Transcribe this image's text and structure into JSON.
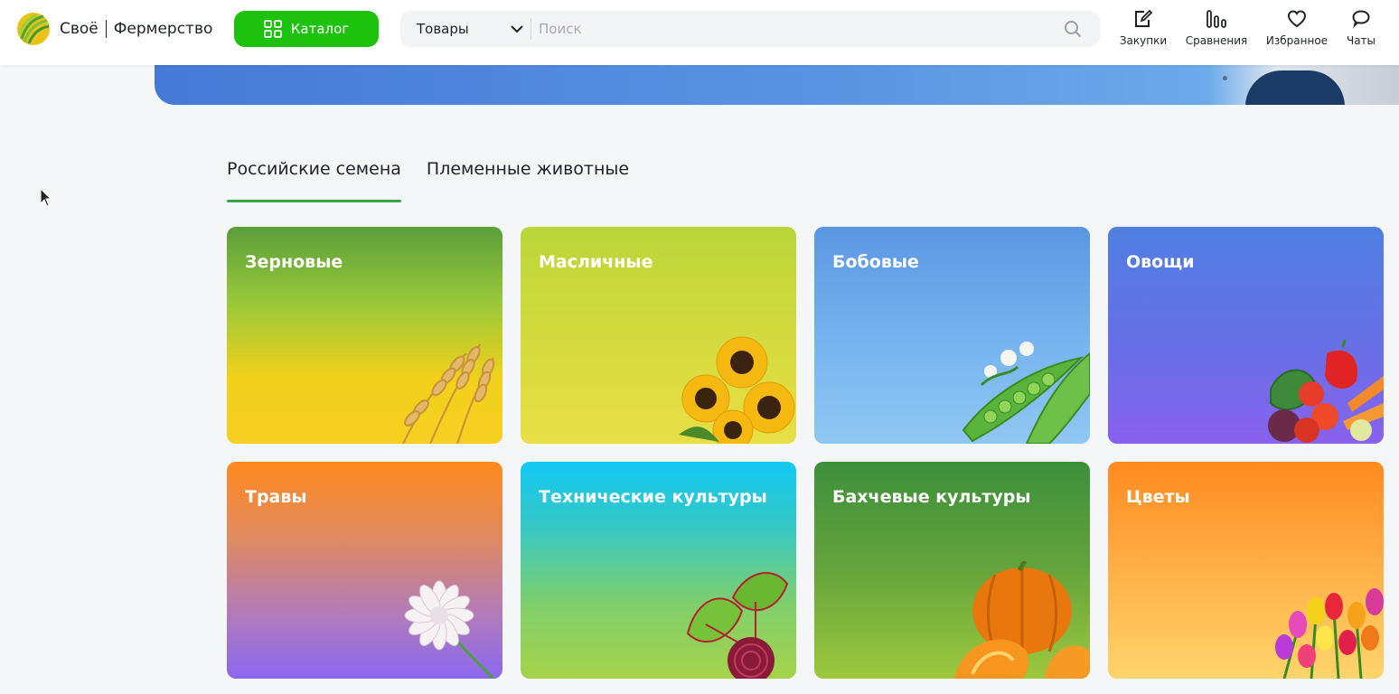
{
  "header": {
    "logo_left": "Своё",
    "logo_right": "Фермерство",
    "catalog_label": "Каталог",
    "search": {
      "category": "Товары",
      "placeholder": "Поиск"
    },
    "nav": [
      {
        "label": "Закупки",
        "icon": "purchase-edit-icon"
      },
      {
        "label": "Сравнения",
        "icon": "compare-bars-icon"
      },
      {
        "label": "Избранное",
        "icon": "heart-icon"
      },
      {
        "label": "Чаты",
        "icon": "chat-bubble-icon"
      }
    ]
  },
  "tabs": [
    {
      "label": "Российские семена",
      "active": true
    },
    {
      "label": "Племенные животные",
      "active": false
    }
  ],
  "categories": [
    {
      "title": "Зерновые",
      "icon": "wheat-icon"
    },
    {
      "title": "Масличные",
      "icon": "sunflower-icon"
    },
    {
      "title": "Бобовые",
      "icon": "peas-icon"
    },
    {
      "title": "Овощи",
      "icon": "vegetables-icon"
    },
    {
      "title": "Травы",
      "icon": "clover-icon"
    },
    {
      "title": "Технические культуры",
      "icon": "beet-icon"
    },
    {
      "title": "Бахчевые культуры",
      "icon": "pumpkin-icon"
    },
    {
      "title": "Цветы",
      "icon": "tulips-icon"
    }
  ],
  "colors": {
    "accent": "#1cc20c",
    "tab_underline": "#3aa548"
  }
}
